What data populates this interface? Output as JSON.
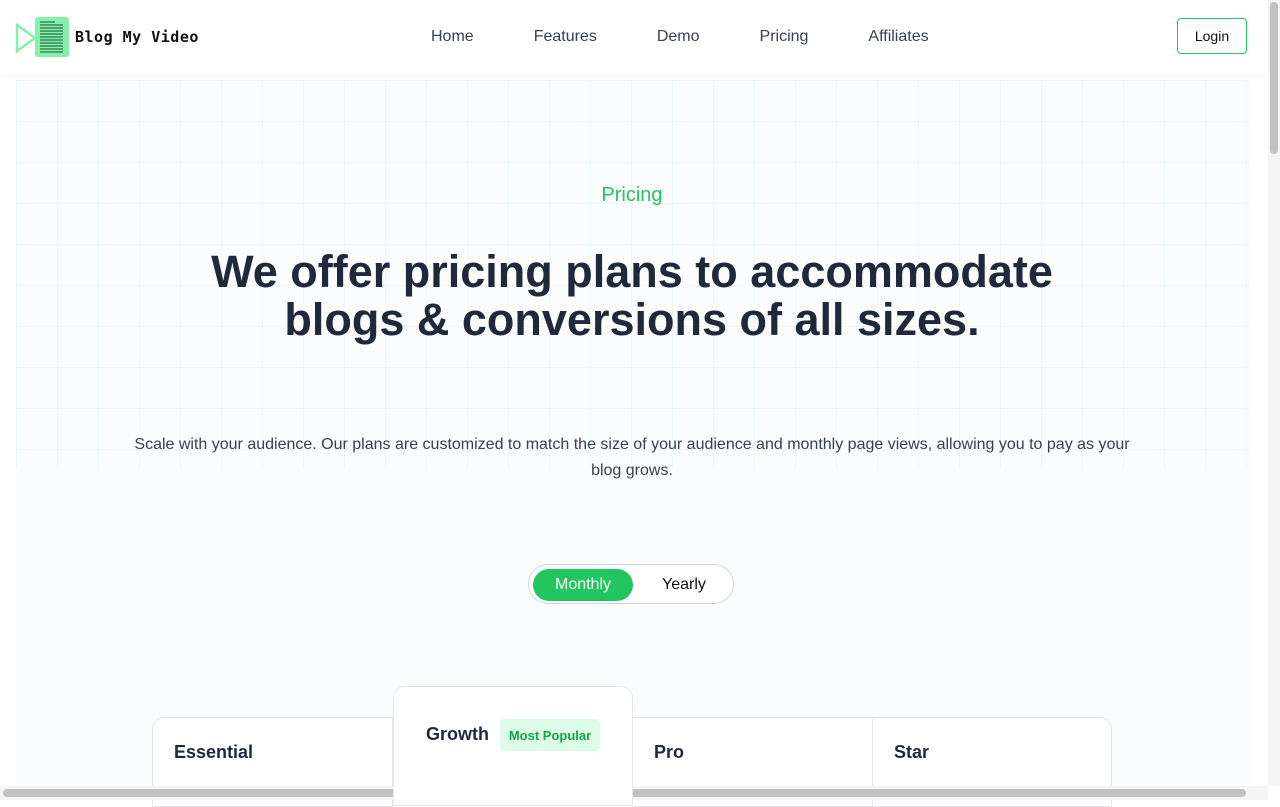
{
  "brand": {
    "name": "Blog My Video",
    "logo_icon": "play-document-icon",
    "accent": "#22c55e"
  },
  "nav": {
    "items": [
      {
        "label": "Home"
      },
      {
        "label": "Features"
      },
      {
        "label": "Demo"
      },
      {
        "label": "Pricing"
      },
      {
        "label": "Affiliates"
      }
    ],
    "login_label": "Login"
  },
  "hero": {
    "eyebrow": "Pricing",
    "headline": "We offer pricing plans to accommodate blogs & conversions of all sizes.",
    "subtext": "Scale with your audience. Our plans are customized to match the size of your audience and monthly page views, allowing you to pay as your blog grows."
  },
  "billing_toggle": {
    "options": [
      "Monthly",
      "Yearly"
    ],
    "selected": "Monthly"
  },
  "plans": [
    {
      "name": "Essential"
    },
    {
      "name": "Growth",
      "badge": "Most Popular"
    },
    {
      "name": "Pro"
    },
    {
      "name": "Star"
    }
  ]
}
